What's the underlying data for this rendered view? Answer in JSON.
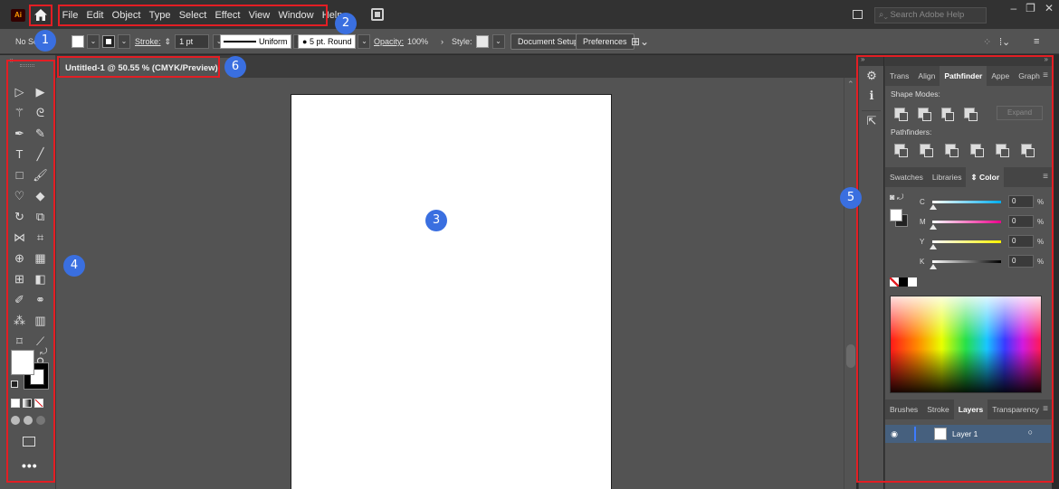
{
  "app": {
    "logo_text": "Ai"
  },
  "menu": [
    "File",
    "Edit",
    "Object",
    "Type",
    "Select",
    "Effect",
    "View",
    "Window",
    "Help"
  ],
  "search": {
    "placeholder": "Search Adobe Help"
  },
  "control_bar": {
    "selection_state": "No Se",
    "stroke_label": "Stroke:",
    "stroke_weight": "1 pt",
    "variable_width": "Uniform",
    "brush": "5 pt. Round",
    "opacity_label": "Opacity:",
    "opacity_value": "100%",
    "style_label": "Style:",
    "document_setup": "Document Setup",
    "preferences": "Preferences"
  },
  "document_tab": {
    "title": "Untitled-1 @ 50.55 % (CMYK/Preview)",
    "close": "×"
  },
  "panels": {
    "top_tabs": [
      {
        "label": "Trans",
        "active": false
      },
      {
        "label": "Align",
        "active": false
      },
      {
        "label": "Pathfinder",
        "active": true
      },
      {
        "label": "Appe",
        "active": false
      },
      {
        "label": "Graph",
        "active": false
      }
    ],
    "shape_modes_label": "Shape Modes:",
    "expand_label": "Expand",
    "pathfinders_label": "Pathfinders:",
    "mid_tabs": [
      {
        "label": "Swatches",
        "active": false
      },
      {
        "label": "Libraries",
        "active": false
      },
      {
        "label": "Color",
        "active": true
      }
    ],
    "color": {
      "sliders": [
        {
          "label": "C",
          "value": "0",
          "color": "#00aeef"
        },
        {
          "label": "M",
          "value": "0",
          "color": "#ec008c"
        },
        {
          "label": "Y",
          "value": "0",
          "color": "#fff200"
        },
        {
          "label": "K",
          "value": "0",
          "color": "#000000"
        }
      ],
      "unit": "%"
    },
    "bottom_tabs": [
      {
        "label": "Brushes",
        "active": false
      },
      {
        "label": "Stroke",
        "active": false
      },
      {
        "label": "Layers",
        "active": true
      },
      {
        "label": "Transparency",
        "active": false
      }
    ],
    "layers": [
      {
        "name": "Layer 1",
        "visible": true
      }
    ]
  },
  "callouts": [
    "1",
    "2",
    "3",
    "4",
    "5",
    "6"
  ],
  "colors": {
    "callout_border": "#e31e24",
    "callout_badge": "#3a6fe0",
    "layer_highlight": "#46607e"
  }
}
